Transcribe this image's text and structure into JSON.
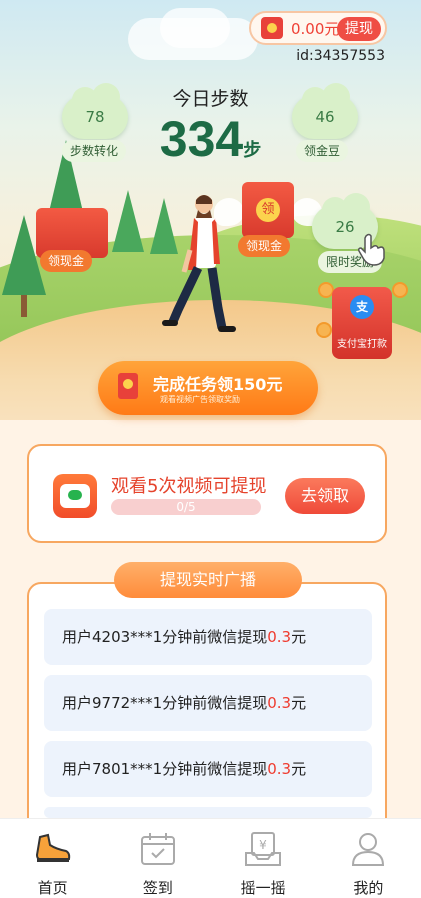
{
  "header": {
    "wallet_amount": "0.00元",
    "withdraw_label": "提现",
    "user_id": "id:34357553"
  },
  "steps": {
    "title": "今日步数",
    "count": "334",
    "unit": "步"
  },
  "bubbles": [
    {
      "value": "78",
      "label": "步数转化"
    },
    {
      "value": "46",
      "label": "领金豆"
    },
    {
      "value": "26",
      "label": "限时奖励"
    }
  ],
  "redpacks": {
    "left_label": "领现金",
    "center_char": "领",
    "center_label": "领现金",
    "alipay_char": "支",
    "alipay_label": "支付宝打款"
  },
  "task": {
    "title": "完成任务领150元",
    "subtitle": "观看视频广告领取奖励"
  },
  "video_card": {
    "title": "观看5次视频可提现",
    "progress_text": "0/5",
    "progress_fraction": 0,
    "button": "去领取"
  },
  "broadcast": {
    "title": "提现实时广播",
    "items": [
      {
        "prefix": "用户4203***1分钟前微信提现",
        "amount": "0.3",
        "suffix": "元"
      },
      {
        "prefix": "用户9772***1分钟前微信提现",
        "amount": "0.3",
        "suffix": "元"
      },
      {
        "prefix": "用户7801***1分钟前微信提现",
        "amount": "0.3",
        "suffix": "元"
      }
    ]
  },
  "nav": [
    {
      "label": "首页",
      "icon": "shoe-icon",
      "active": true
    },
    {
      "label": "签到",
      "icon": "calendar-check-icon",
      "active": false
    },
    {
      "label": "摇一摇",
      "icon": "shake-cash-icon",
      "active": false
    },
    {
      "label": "我的",
      "icon": "user-icon",
      "active": false
    }
  ],
  "colors": {
    "accent_orange": "#ff8c3a",
    "accent_red": "#ef4136",
    "steps_green": "#1d6b45"
  }
}
